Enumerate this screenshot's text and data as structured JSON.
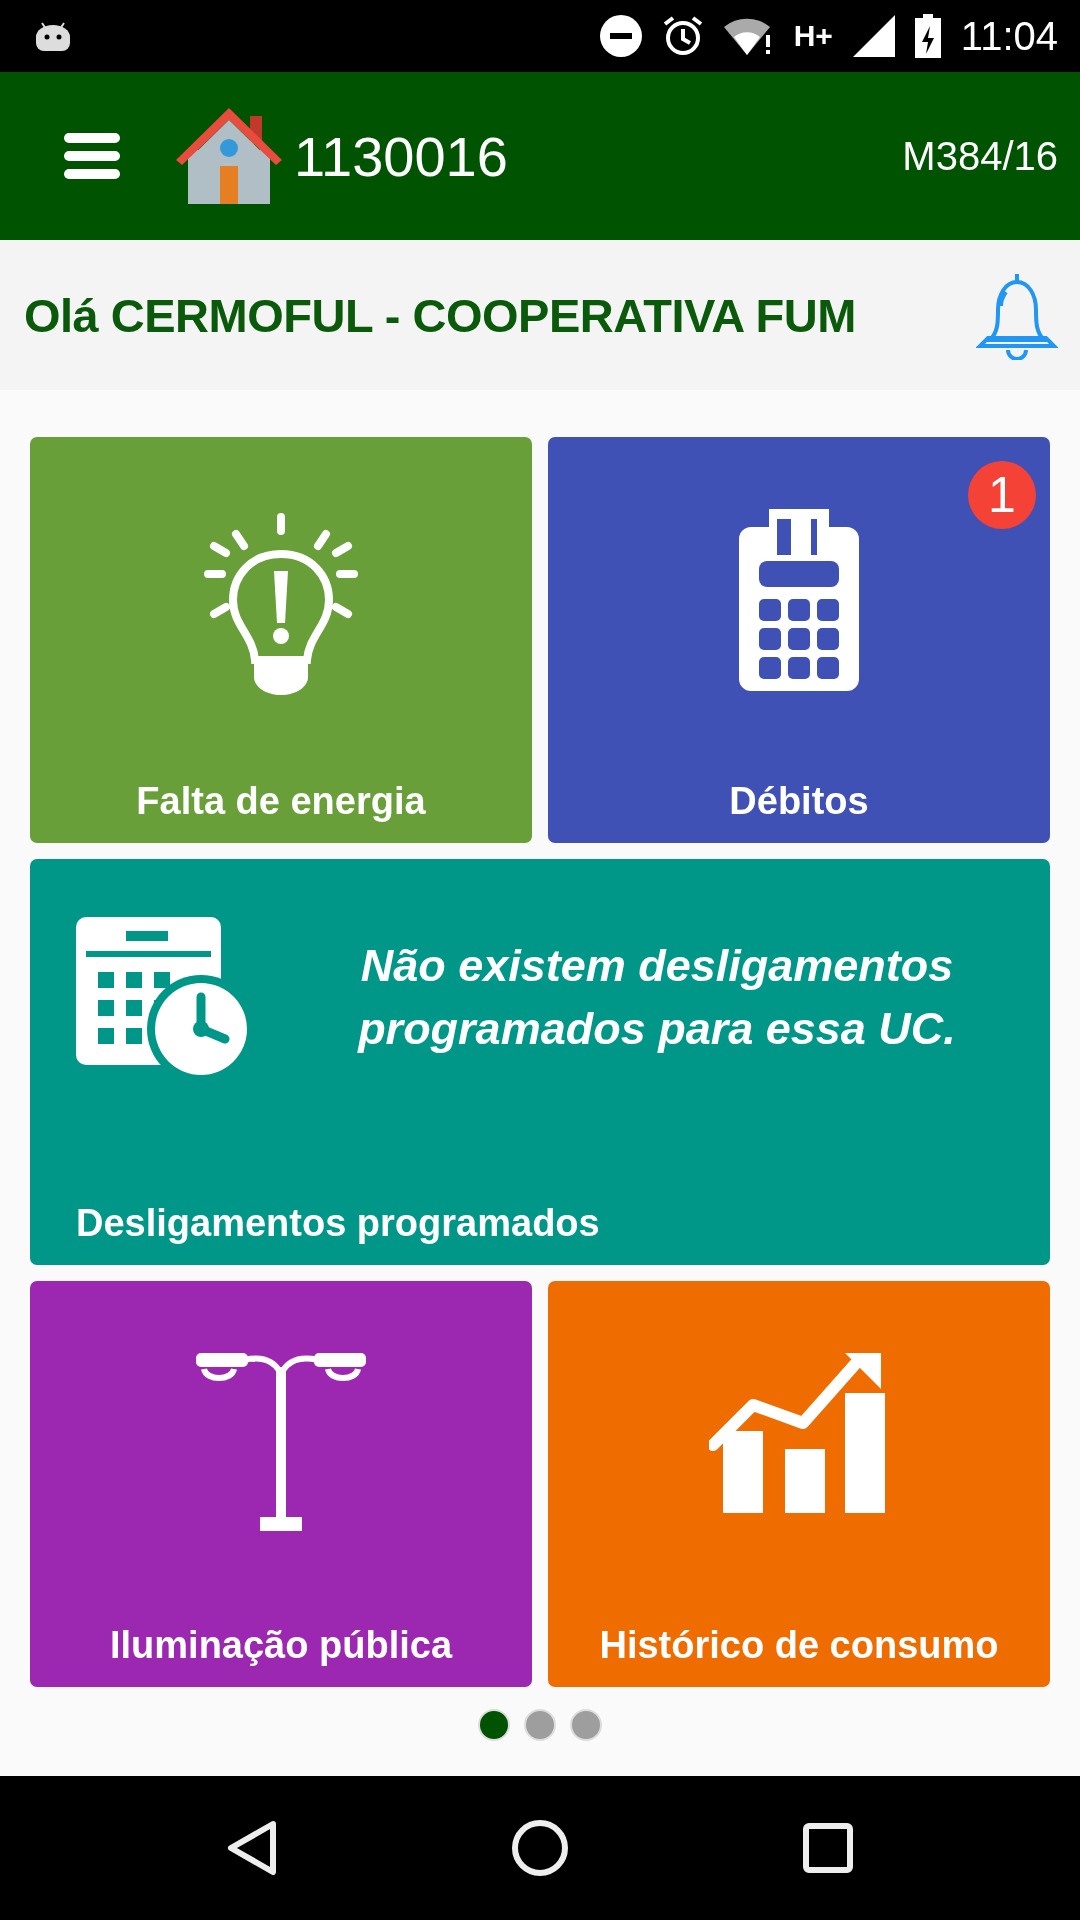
{
  "status_bar": {
    "network": "H+",
    "time": "11:04"
  },
  "app_bar": {
    "account": "1130016",
    "code": "M384/16"
  },
  "greeting": "Olá CERMOFUL - COOPERATIVA FUM",
  "tiles": [
    {
      "kind": "outage",
      "label": "Falta de energia",
      "color": "#689f38"
    },
    {
      "kind": "debts",
      "label": "Débitos",
      "color": "#3f51b5",
      "badge": "1"
    },
    {
      "kind": "schedule",
      "label": "Desligamentos programados",
      "color": "#009688",
      "message": "Não existem desligamentos programados para essa UC."
    },
    {
      "kind": "lighting",
      "label": "Iluminação pública",
      "color": "#9c27b0"
    },
    {
      "kind": "consumption",
      "label": "Histórico de consumo",
      "color": "#ef6c00"
    }
  ],
  "pages": [
    {
      "selected": true
    },
    {
      "selected": false
    },
    {
      "selected": false
    }
  ]
}
